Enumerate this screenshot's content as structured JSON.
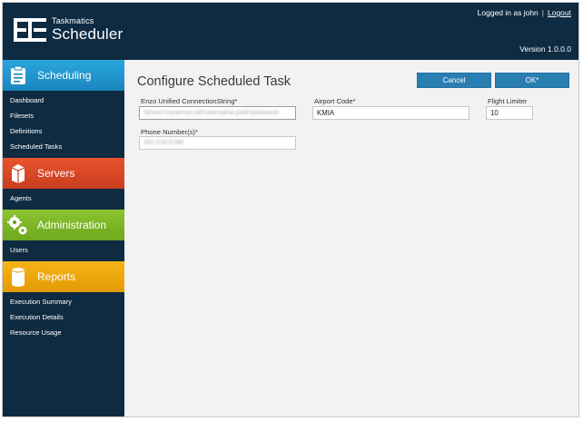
{
  "app": {
    "brand_small": "Taskmatics",
    "brand_big": "Scheduler",
    "logged_in_text": "Logged in as john",
    "separator": "|",
    "logout_label": "Logout",
    "version": "Version 1.0.0.0"
  },
  "sidebar": {
    "sections": [
      {
        "title": "Scheduling",
        "icon": "clipboard-icon",
        "color": "#2aa6dc",
        "items": [
          "Dashboard",
          "Filesets",
          "Definitions",
          "Scheduled Tasks"
        ]
      },
      {
        "title": "Servers",
        "icon": "server-icon",
        "color": "#e8532f",
        "items": [
          "Agents"
        ]
      },
      {
        "title": "Administration",
        "icon": "gears-icon",
        "color": "#8cc431",
        "items": [
          "Users"
        ]
      },
      {
        "title": "Reports",
        "icon": "database-icon",
        "color": "#f6b417",
        "items": [
          "Execution Summary",
          "Execution Details",
          "Resource Usage"
        ]
      }
    ]
  },
  "main": {
    "title": "Configure Scheduled Task",
    "cancel_label": "Cancel",
    "ok_label": "OK*",
    "fields": {
      "connection_label": "Enzo Unified ConnectionString*",
      "connection_value": "Server=myserver;uid=username;pwd=password",
      "airport_label": "Airport Code*",
      "airport_value": "KMIA",
      "flight_label": "Flight Limiter",
      "flight_value": "10",
      "phone_label": "Phone Number(s)*",
      "phone_value": "352-518-5788"
    }
  },
  "colors": {
    "header_bg": "#0e2b42",
    "accent_button": "#2a7fb2"
  }
}
